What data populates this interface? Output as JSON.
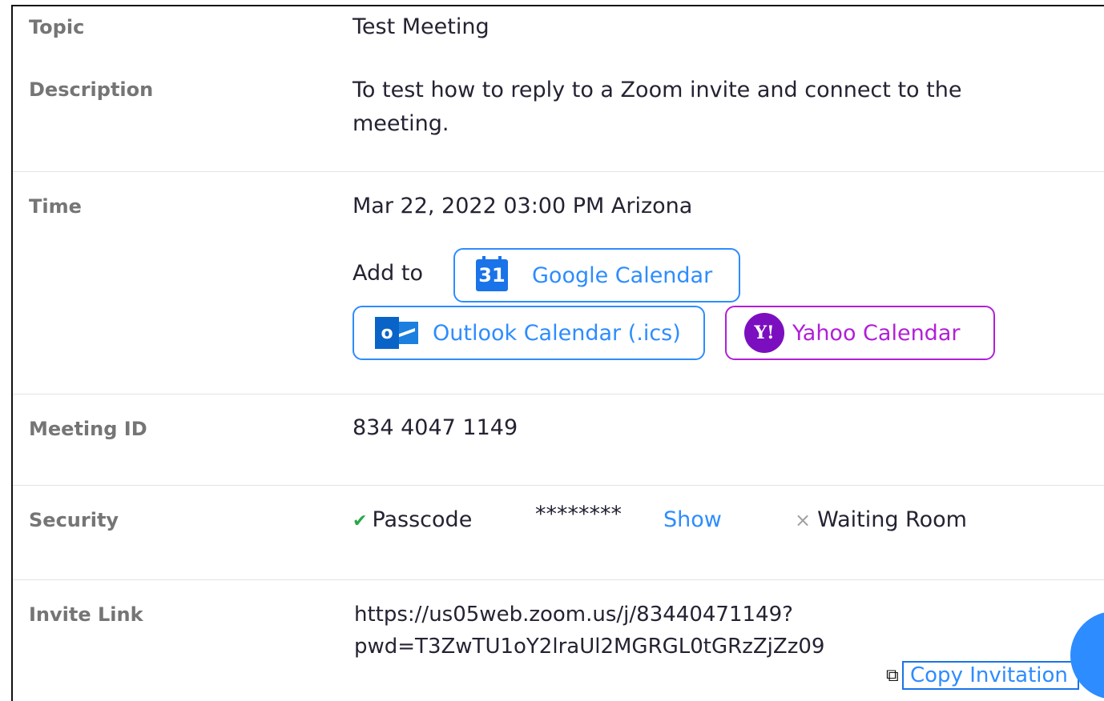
{
  "rows": {
    "topic": {
      "label": "Topic",
      "value": "Test Meeting"
    },
    "description": {
      "label": "Description",
      "line1": "To test how to reply to a Zoom invite and connect to the",
      "line2": "meeting."
    },
    "time": {
      "label": "Time",
      "value": "Mar 22, 2022 03:00 PM Arizona",
      "add_to": "Add to"
    },
    "meeting_id": {
      "label": "Meeting ID",
      "value": "834 4047 1149"
    },
    "security": {
      "label": "Security",
      "passcode_label": "Passcode",
      "passcode_value": "********",
      "show_label": "Show",
      "waiting_room_label": "Waiting Room"
    },
    "invite_link": {
      "label": "Invite Link",
      "line1": "https://us05web.zoom.us/j/83440471149?",
      "line2": "pwd=T3ZwTU1oY2lraUl2MGRGL0tGRzZjZz09"
    }
  },
  "calendar_buttons": {
    "google": {
      "label": "Google Calendar",
      "icon": "google-calendar-icon",
      "icon_text": "31"
    },
    "outlook": {
      "label": "Outlook Calendar (.ics)",
      "icon": "outlook-icon",
      "icon_text": "o"
    },
    "yahoo": {
      "label": "Yahoo Calendar",
      "icon": "yahoo-icon",
      "icon_text": "Y!"
    }
  },
  "copy_invitation": {
    "label": "Copy Invitation",
    "icon": "copy-icon"
  },
  "colors": {
    "accent": "#2D8CFF",
    "yahoo": "#B11FD8",
    "check": "#28A745",
    "label_gray": "#757575"
  }
}
